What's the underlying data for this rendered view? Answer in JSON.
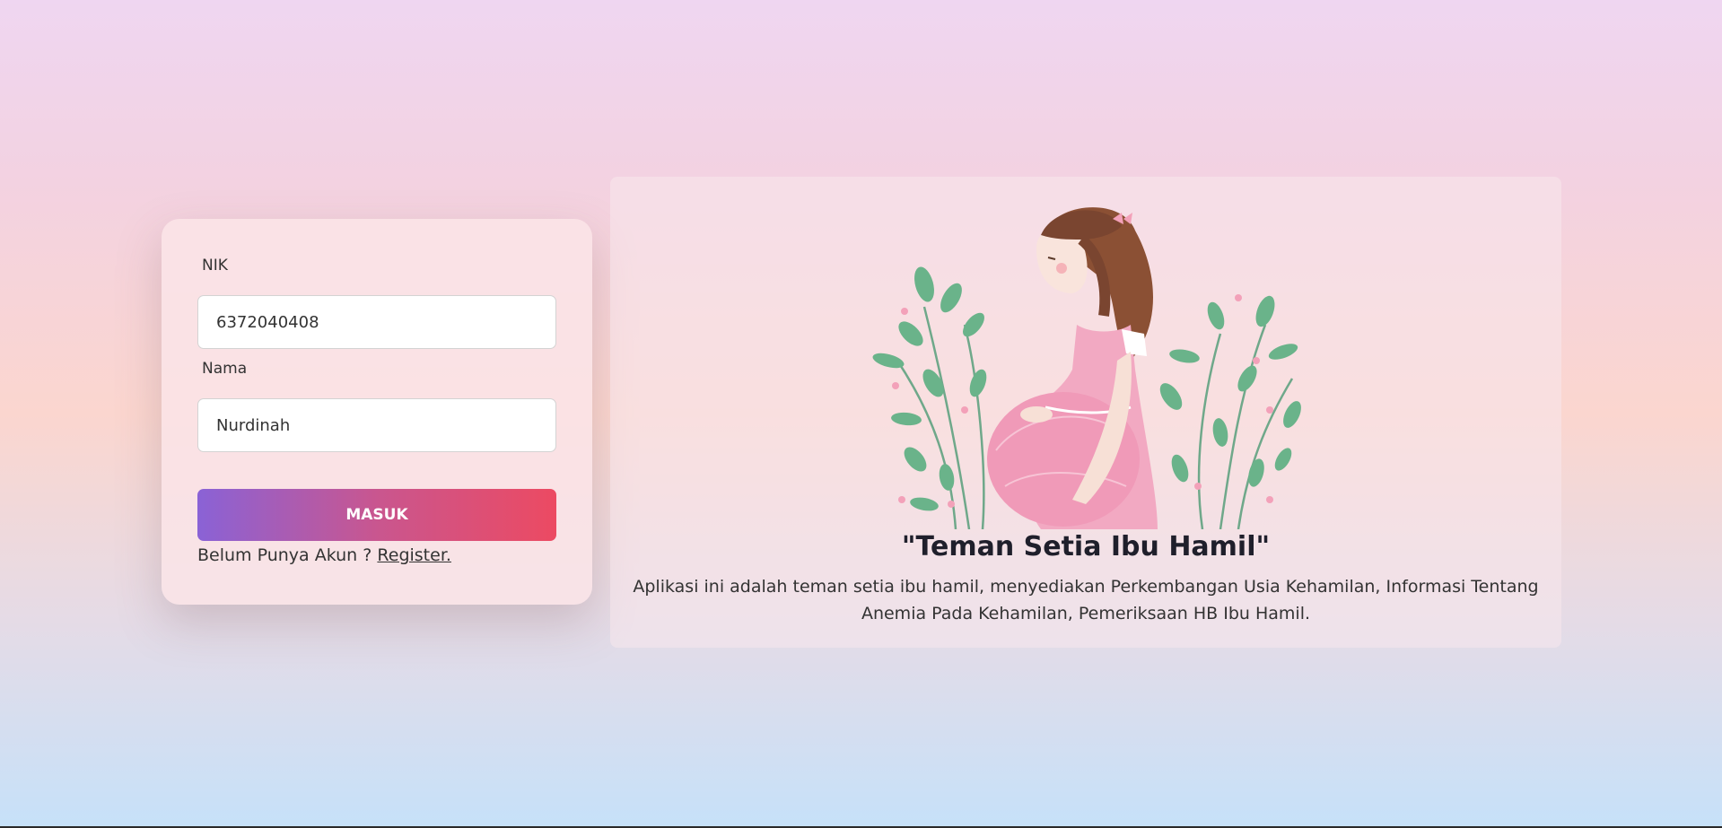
{
  "login_form": {
    "nik_label": "NIK",
    "nik_value": "6372040408",
    "nama_label": "Nama",
    "nama_value": "Nurdinah",
    "submit_label": "MASUK",
    "register_prompt": "Belum Punya Akun ?",
    "register_link": "Register."
  },
  "hero": {
    "title": "\"Teman Setia Ibu Hamil\"",
    "description": "Aplikasi ini adalah teman setia ibu hamil, menyediakan Perkembangan Usia Kehamilan, Informasi Tentang Anemia Pada Kehamilan, Pemeriksaan HB Ibu Hamil.",
    "illustration": "pregnant-woman-illustration"
  },
  "colors": {
    "button_gradient_start": "#8a62d6",
    "button_gradient_end": "#ec4a62",
    "dress_pink": "#f2a9c2",
    "leaf_green": "#6ab38a"
  }
}
